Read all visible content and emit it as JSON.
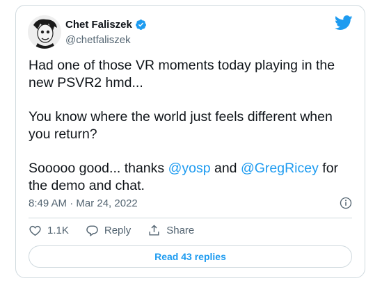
{
  "tweet": {
    "author_name": "Chet Faliszek",
    "author_handle": "@chetfaliszek",
    "paragraph1": "Had one of those VR moments today playing in the new PSVR2 hmd...",
    "paragraph2": "You know where the world just feels different when you return?",
    "p3_start": "Sooooo good... thanks ",
    "mention1": "@yosp",
    "p3_mid": " and ",
    "mention2": "@GregRicey",
    "p3_end": " for the demo and chat.",
    "timestamp": "8:49 AM · Mar 24, 2022"
  },
  "actions": {
    "like_count": "1.1K",
    "reply_label": "Reply",
    "share_label": "Share"
  },
  "replies_button": "Read 43 replies",
  "colors": {
    "accent": "#1d9bf0",
    "verified": "#1d9bf0",
    "muted": "#536471",
    "border": "#cfd9de"
  }
}
